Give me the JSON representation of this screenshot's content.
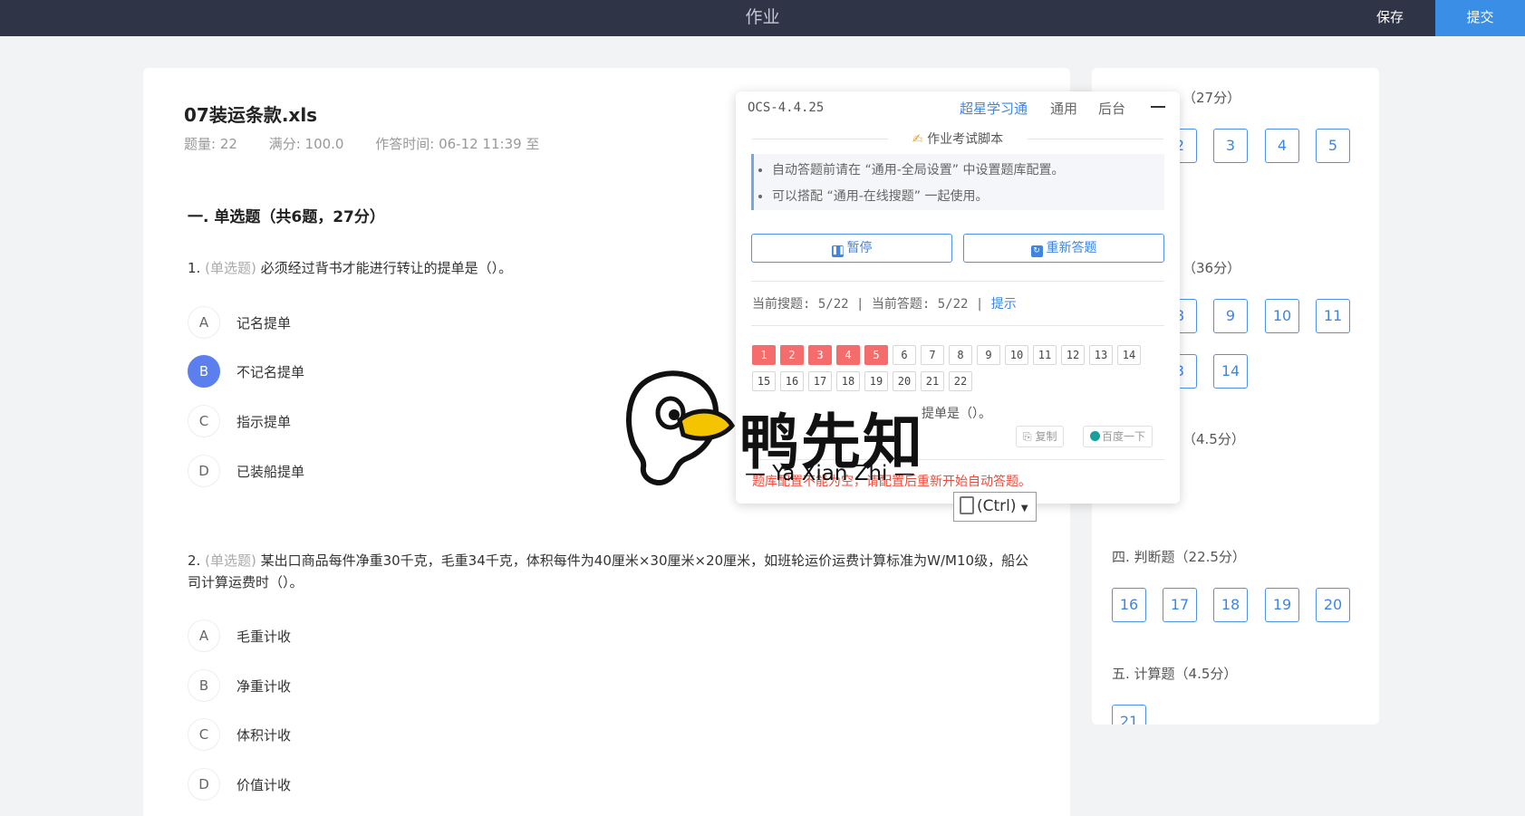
{
  "topbar": {
    "title": "作业",
    "save": "保存",
    "submit": "提交"
  },
  "doc": {
    "title": "07装运条款.xls",
    "meta": {
      "count": "题量: 22",
      "score": "满分: 100.0",
      "time": "作答时间: 06-12 11:39  至"
    },
    "section": "一. 单选题（共6题，27分）"
  },
  "questions": [
    {
      "num": "1.",
      "type": "(单选题)",
      "text": "必须经过背书才能进行转让的提单是（）。",
      "options": [
        {
          "letter": "A",
          "text": "记名提单",
          "selected": false
        },
        {
          "letter": "B",
          "text": "不记名提单",
          "selected": true
        },
        {
          "letter": "C",
          "text": "指示提单",
          "selected": false
        },
        {
          "letter": "D",
          "text": "已装船提单",
          "selected": false
        }
      ]
    },
    {
      "num": "2.",
      "type": "(单选题)",
      "text": "某出口商品每件净重30千克，毛重34千克，体积每件为40厘米×30厘米×20厘米，如班轮运价运费计算标准为W/M10级，船公司计算运费时（）。",
      "options": [
        {
          "letter": "A",
          "text": "毛重计收",
          "selected": false
        },
        {
          "letter": "B",
          "text": "净重计收",
          "selected": false
        },
        {
          "letter": "C",
          "text": "体积计收",
          "selected": false
        },
        {
          "letter": "D",
          "text": "价值计收",
          "selected": false
        }
      ]
    }
  ],
  "side": {
    "sections": [
      {
        "head": "（27分）",
        "buttons": [
          "2",
          "3",
          "4",
          "5"
        ]
      },
      {
        "head": "（36分）",
        "buttons": [
          "8",
          "9",
          "10",
          "11"
        ],
        "buttons2": [
          "3",
          "14"
        ]
      },
      {
        "head": "（4.5分）"
      },
      {
        "head": "四. 判断题（22.5分）",
        "buttons": [
          "16",
          "17",
          "18",
          "19",
          "20"
        ]
      },
      {
        "head": "五. 计算题（4.5分）",
        "buttons": [
          "21"
        ]
      }
    ]
  },
  "ocs": {
    "version": "OCS-4.4.25",
    "nav": [
      "超星学习通",
      "通用",
      "后台"
    ],
    "script_title": "作业考试脚本",
    "tips": [
      "自动答题前请在 “通用-全局设置” 中设置题库配置。",
      "可以搭配 “通用-在线搜题” 一起使用。"
    ],
    "pause": "暂停",
    "restart": "重新答题",
    "status_search": "当前搜题: 5/22",
    "status_answer": "当前答题: 5/22",
    "hint": "提示",
    "numbers": [
      "1",
      "2",
      "3",
      "4",
      "5",
      "6",
      "7",
      "8",
      "9",
      "10",
      "11",
      "12",
      "13",
      "14",
      "15",
      "16",
      "17",
      "18",
      "19",
      "20",
      "21",
      "22"
    ],
    "done_count": 5,
    "question_fragment": "提单是（）。",
    "copy": "复制",
    "baidu": "百度一下",
    "error": "题库配置不能为空，请配置后重新开始自动答题。"
  },
  "ctrl": "(Ctrl)",
  "watermark": {
    "main": "鸭先知",
    "sub": "— Ya Xian Zhi —"
  },
  "colors": {
    "accent": "#3a8ee6",
    "topbar": "#2f3447",
    "done": "#f56c6c",
    "selected": "#5b7fef"
  }
}
